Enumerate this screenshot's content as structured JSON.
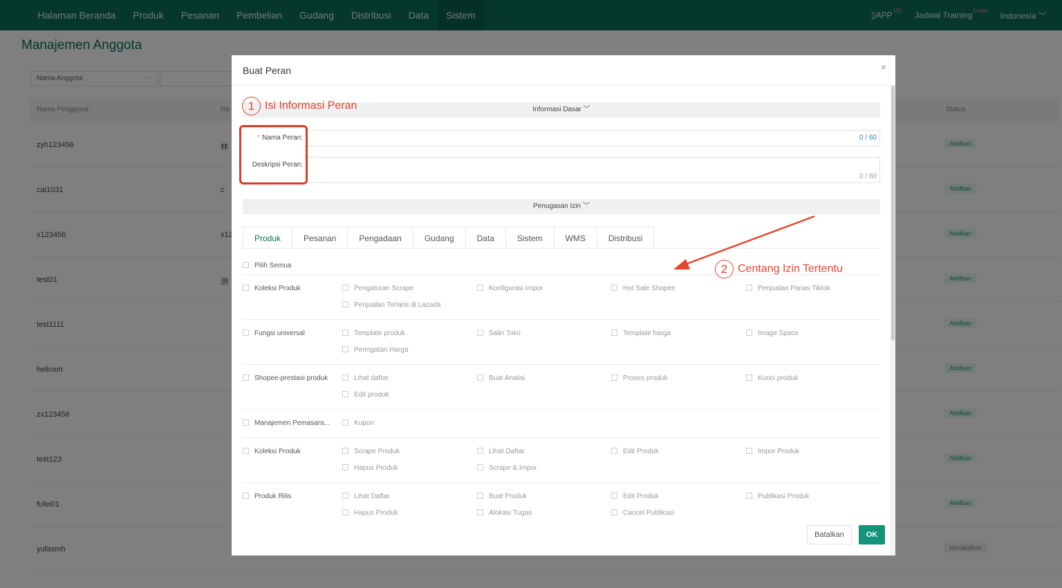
{
  "nav": {
    "items": [
      "Halaman Beranda",
      "Produk",
      "Pesanan",
      "Pembelian",
      "Gudang",
      "Distribusi",
      "Data",
      "Sistem"
    ],
    "app_label": "APP",
    "app_badge": "101",
    "training_label": "Jadwal Training",
    "training_badge": "Gratis",
    "language": "Indonesia"
  },
  "page": {
    "title": "Manajemen Anggota",
    "filter_select": "Nama Anggota",
    "columns": {
      "username": "Nama Pengguna",
      "name": "Na",
      "status": "Status"
    },
    "rows": [
      {
        "username": "zyh123456",
        "name": "林",
        "status": "Aktifkan"
      },
      {
        "username": "cai1031",
        "name": "c",
        "status": "Aktifkan"
      },
      {
        "username": "x123456",
        "name": "x12",
        "status": "Aktifkan"
      },
      {
        "username": "test01",
        "name": "测",
        "status": "Aktifkan"
      },
      {
        "username": "test1111",
        "name": "",
        "status": "Aktifkan"
      },
      {
        "username": "helloxm",
        "name": "",
        "status": "Aktifkan"
      },
      {
        "username": "zx123456",
        "name": "",
        "status": "Aktifkan"
      },
      {
        "username": "test123",
        "name": "",
        "status": "Aktifkan"
      },
      {
        "username": "fufei01",
        "name": "",
        "status": "Aktifkan"
      },
      {
        "username": "yufasmh",
        "name": "",
        "status": "Nonaktifkan"
      }
    ]
  },
  "modal": {
    "title": "Buat Peran",
    "close": "×",
    "section_basic": "Informasi Dasar",
    "role_name_label": "Nama Peran:",
    "role_name_required": "*",
    "role_name_counter": "0 / 60",
    "role_desc_label": "Deskripsi Peran:",
    "role_desc_counter": "0 / 60",
    "section_permission": "Penugasan Izin",
    "tabs": [
      "Produk",
      "Pesanan",
      "Pengadaan",
      "Gudang",
      "Data",
      "Sistem",
      "WMS",
      "Distribusi"
    ],
    "select_all": "Pilih Semua",
    "groups": [
      {
        "name": "Koleksi Produk",
        "perms": [
          "Pengaturan Scrape",
          "Konfigurasi Impor",
          "Hot Sale Shopee",
          "Penjualan Panas Tiktok",
          "Penjualan Terlaris di Lazada"
        ]
      },
      {
        "name": "Fungsi universal",
        "perms": [
          "Template produk",
          "Salin Toko",
          "Template harga",
          "Image Space",
          "Peringatan Harga"
        ]
      },
      {
        "name": "Shopee-prestasi produk",
        "perms": [
          "Lihat daftar",
          "Buat Analisi",
          "Proses produk",
          "Kunci produk",
          "Edit produk"
        ]
      },
      {
        "name": "Manajemen Pemasara...",
        "perms": [
          "Kupon"
        ]
      },
      {
        "name": "Koleksi Produk",
        "perms": [
          "Scrape Produk",
          "Lihat Daftar",
          "Edit Produk",
          "Impor Produk",
          "Hapus Produk",
          "Scrape & Impor"
        ]
      },
      {
        "name": "Produk Rilis",
        "perms": [
          "Lihat Daftar",
          "Buat Produk",
          "Edit Produk",
          "Publikasi Produk",
          "Hapus Produk",
          "Alokasi Tugas",
          "Cancel Publikasi"
        ]
      }
    ],
    "cancel_label": "Batalkan",
    "ok_label": "OK"
  },
  "annotations": {
    "step1_num": "1",
    "step1_text": "Isi Informasi Peran",
    "step2_num": "2",
    "step2_text": "Centang Izin Tertentu"
  },
  "colors": {
    "brand": "#0b6e5a",
    "ok_button": "#12937a",
    "annotation": "#e8442e"
  }
}
